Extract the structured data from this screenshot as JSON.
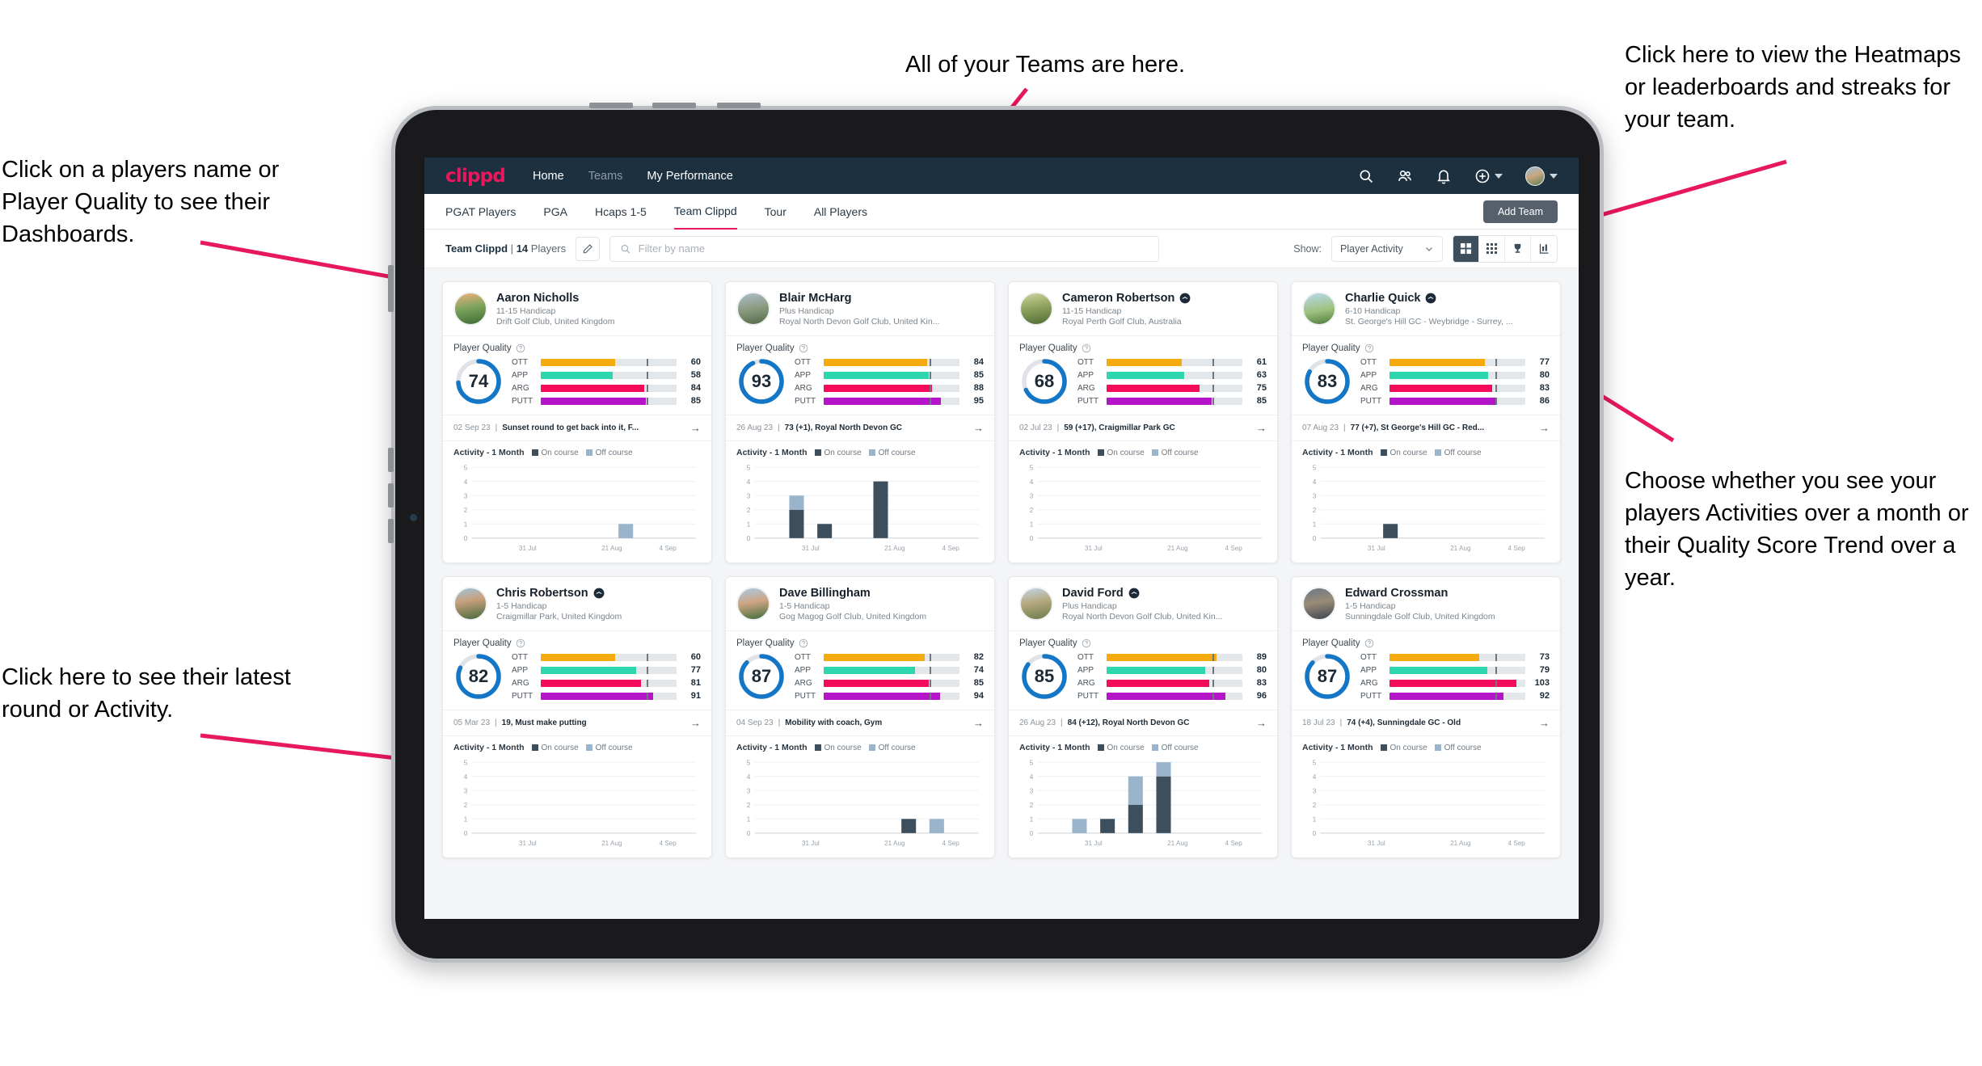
{
  "annotations": {
    "top_left": "Click on a players name or Player Quality to see their Dashboards.",
    "bottom_left": "Click here to see their latest round or Activity.",
    "top_center": "All of your Teams are here.",
    "top_right": "Click here to view the Heatmaps or leaderboards and streaks for your team.",
    "mid_right": "Choose whether you see your players Activities over a month or their Quality Score Trend over a year.",
    "arrow_color": "#e8185d"
  },
  "topnav": {
    "logo": "clippd",
    "links": [
      {
        "label": "Home",
        "active": true
      },
      {
        "label": "Teams",
        "active": false
      },
      {
        "label": "My Performance",
        "active": true
      }
    ],
    "icons": [
      "search-icon",
      "people-icon",
      "bell-icon",
      "plus-circle-icon",
      "avatar"
    ]
  },
  "subnav": {
    "tabs": [
      {
        "label": "PGAT Players",
        "state": "normal"
      },
      {
        "label": "PGA",
        "state": "normal"
      },
      {
        "label": "Hcaps 1-5",
        "state": "normal"
      },
      {
        "label": "Team Clippd",
        "state": "active"
      },
      {
        "label": "Tour",
        "state": "normal"
      },
      {
        "label": "All Players",
        "state": "normal"
      }
    ],
    "add_team_label": "Add Team"
  },
  "filterbar": {
    "team_name": "Team Clippd",
    "separator": "|",
    "player_count": "14",
    "players_word": "Players",
    "search_placeholder": "Filter by name",
    "search_value": "",
    "show_label": "Show:",
    "show_value": "Player Activity",
    "show_options": [
      "Player Activity",
      "Quality Score Trend"
    ],
    "view_buttons": [
      "grid-large-icon",
      "grid-small-icon",
      "trophy-icon",
      "chart-icon"
    ],
    "active_view": "grid-large-icon"
  },
  "card_labels": {
    "player_quality": "Player Quality",
    "activity": "Activity - 1 Month",
    "legend_on": "On course",
    "legend_off": "Off course"
  },
  "colors": {
    "ott": "#f5ab0d",
    "app": "#2ed6ae",
    "arg": "#f50b5c",
    "putt": "#b515c9",
    "ring": "#1476c6",
    "on_course": "#3d4f5c",
    "off_course": "#9ab4cc",
    "brand": "#e8185d",
    "nav_bg": "#1c3040"
  },
  "players": [
    {
      "name": "Aaron Nicholls",
      "verified": false,
      "handicap": "11-15 Handicap",
      "club": "Drift Golf Club, United Kingdom",
      "quality_score": 74,
      "metrics": [
        {
          "label": "OTT",
          "value": 60,
          "color": "ott"
        },
        {
          "label": "APP",
          "value": 58,
          "color": "app"
        },
        {
          "label": "ARG",
          "value": 84,
          "color": "arg"
        },
        {
          "label": "PUTT",
          "value": 85,
          "color": "putt"
        }
      ],
      "latest_date": "02 Sep 23",
      "latest_text": "Sunset round to get back into it, F...",
      "chart_data": {
        "type": "bar",
        "title": "Activity - 1 Month",
        "categories": [
          "31 Jul",
          "21 Aug",
          "4 Sep"
        ],
        "ylim": [
          0,
          5
        ],
        "yticks": [
          0,
          1,
          2,
          3,
          4,
          5
        ],
        "series": [
          {
            "name": "On course",
            "values": [
              0,
              0,
              0,
              0,
              0,
              0,
              0,
              0
            ]
          },
          {
            "name": "Off course",
            "values": [
              0,
              0,
              0,
              0,
              0,
              1,
              0,
              0
            ]
          }
        ]
      }
    },
    {
      "name": "Blair McHarg",
      "verified": false,
      "handicap": "Plus Handicap",
      "club": "Royal North Devon Golf Club, United Kin...",
      "quality_score": 93,
      "metrics": [
        {
          "label": "OTT",
          "value": 84,
          "color": "ott"
        },
        {
          "label": "APP",
          "value": 85,
          "color": "app"
        },
        {
          "label": "ARG",
          "value": 88,
          "color": "arg"
        },
        {
          "label": "PUTT",
          "value": 95,
          "color": "putt"
        }
      ],
      "latest_date": "26 Aug 23",
      "latest_text": "73 (+1), Royal North Devon GC",
      "chart_data": {
        "type": "bar",
        "title": "Activity - 1 Month",
        "categories": [
          "31 Jul",
          "21 Aug",
          "4 Sep"
        ],
        "ylim": [
          0,
          5
        ],
        "yticks": [
          0,
          1,
          2,
          3,
          4,
          5
        ],
        "series": [
          {
            "name": "On course",
            "values": [
              0,
              2,
              1,
              0,
              4,
              0,
              0,
              0
            ]
          },
          {
            "name": "Off course",
            "values": [
              0,
              1,
              0,
              0,
              0,
              0,
              0,
              0
            ]
          }
        ]
      }
    },
    {
      "name": "Cameron Robertson",
      "verified": true,
      "handicap": "11-15 Handicap",
      "club": "Royal Perth Golf Club, Australia",
      "quality_score": 68,
      "metrics": [
        {
          "label": "OTT",
          "value": 61,
          "color": "ott"
        },
        {
          "label": "APP",
          "value": 63,
          "color": "app"
        },
        {
          "label": "ARG",
          "value": 75,
          "color": "arg"
        },
        {
          "label": "PUTT",
          "value": 85,
          "color": "putt"
        }
      ],
      "latest_date": "02 Jul 23",
      "latest_text": "59 (+17), Craigmillar Park GC",
      "chart_data": {
        "type": "bar",
        "title": "Activity - 1 Month",
        "categories": [
          "31 Jul",
          "21 Aug",
          "4 Sep"
        ],
        "ylim": [
          0,
          5
        ],
        "yticks": [
          0,
          1,
          2,
          3,
          4,
          5
        ],
        "series": [
          {
            "name": "On course",
            "values": [
              0,
              0,
              0,
              0,
              0,
              0,
              0,
              0
            ]
          },
          {
            "name": "Off course",
            "values": [
              0,
              0,
              0,
              0,
              0,
              0,
              0,
              0
            ]
          }
        ]
      }
    },
    {
      "name": "Charlie Quick",
      "verified": true,
      "handicap": "6-10 Handicap",
      "club": "St. George's Hill GC - Weybridge - Surrey, ...",
      "quality_score": 83,
      "metrics": [
        {
          "label": "OTT",
          "value": 77,
          "color": "ott"
        },
        {
          "label": "APP",
          "value": 80,
          "color": "app"
        },
        {
          "label": "ARG",
          "value": 83,
          "color": "arg"
        },
        {
          "label": "PUTT",
          "value": 86,
          "color": "putt"
        }
      ],
      "latest_date": "07 Aug 23",
      "latest_text": "77 (+7), St George's Hill GC - Red...",
      "chart_data": {
        "type": "bar",
        "title": "Activity - 1 Month",
        "categories": [
          "31 Jul",
          "21 Aug",
          "4 Sep"
        ],
        "ylim": [
          0,
          5
        ],
        "yticks": [
          0,
          1,
          2,
          3,
          4,
          5
        ],
        "series": [
          {
            "name": "On course",
            "values": [
              0,
              0,
              1,
              0,
              0,
              0,
              0,
              0
            ]
          },
          {
            "name": "Off course",
            "values": [
              0,
              0,
              0,
              0,
              0,
              0,
              0,
              0
            ]
          }
        ]
      }
    },
    {
      "name": "Chris Robertson",
      "verified": true,
      "handicap": "1-5 Handicap",
      "club": "Craigmillar Park, United Kingdom",
      "quality_score": 82,
      "metrics": [
        {
          "label": "OTT",
          "value": 60,
          "color": "ott"
        },
        {
          "label": "APP",
          "value": 77,
          "color": "app"
        },
        {
          "label": "ARG",
          "value": 81,
          "color": "arg"
        },
        {
          "label": "PUTT",
          "value": 91,
          "color": "putt"
        }
      ],
      "latest_date": "05 Mar 23",
      "latest_text": "19, Must make putting",
      "chart_data": {
        "type": "bar",
        "title": "Activity - 1 Month",
        "categories": [
          "31 Jul",
          "21 Aug",
          "4 Sep"
        ],
        "ylim": [
          0,
          5
        ],
        "yticks": [
          0,
          1,
          2,
          3,
          4,
          5
        ],
        "series": [
          {
            "name": "On course",
            "values": [
              0,
              0,
              0,
              0,
              0,
              0,
              0,
              0
            ]
          },
          {
            "name": "Off course",
            "values": [
              0,
              0,
              0,
              0,
              0,
              0,
              0,
              0
            ]
          }
        ]
      }
    },
    {
      "name": "Dave Billingham",
      "verified": false,
      "handicap": "1-5 Handicap",
      "club": "Gog Magog Golf Club, United Kingdom",
      "quality_score": 87,
      "metrics": [
        {
          "label": "OTT",
          "value": 82,
          "color": "ott"
        },
        {
          "label": "APP",
          "value": 74,
          "color": "app"
        },
        {
          "label": "ARG",
          "value": 85,
          "color": "arg"
        },
        {
          "label": "PUTT",
          "value": 94,
          "color": "putt"
        }
      ],
      "latest_date": "04 Sep 23",
      "latest_text": "Mobility with coach, Gym",
      "chart_data": {
        "type": "bar",
        "title": "Activity - 1 Month",
        "categories": [
          "31 Jul",
          "21 Aug",
          "4 Sep"
        ],
        "ylim": [
          0,
          5
        ],
        "yticks": [
          0,
          1,
          2,
          3,
          4,
          5
        ],
        "series": [
          {
            "name": "On course",
            "values": [
              0,
              0,
              0,
              0,
              0,
              1,
              0,
              0
            ]
          },
          {
            "name": "Off course",
            "values": [
              0,
              0,
              0,
              0,
              0,
              0,
              1,
              0
            ]
          }
        ]
      }
    },
    {
      "name": "David Ford",
      "verified": true,
      "handicap": "Plus Handicap",
      "club": "Royal North Devon Golf Club, United Kin...",
      "quality_score": 85,
      "metrics": [
        {
          "label": "OTT",
          "value": 89,
          "color": "ott"
        },
        {
          "label": "APP",
          "value": 80,
          "color": "app"
        },
        {
          "label": "ARG",
          "value": 83,
          "color": "arg"
        },
        {
          "label": "PUTT",
          "value": 96,
          "color": "putt"
        }
      ],
      "latest_date": "26 Aug 23",
      "latest_text": "84 (+12), Royal North Devon GC",
      "chart_data": {
        "type": "bar",
        "title": "Activity - 1 Month",
        "categories": [
          "31 Jul",
          "21 Aug",
          "4 Sep"
        ],
        "ylim": [
          0,
          5
        ],
        "yticks": [
          0,
          1,
          2,
          3,
          4,
          5
        ],
        "series": [
          {
            "name": "On course",
            "values": [
              0,
              0,
              1,
              2,
              4,
              0,
              0,
              0
            ]
          },
          {
            "name": "Off course",
            "values": [
              0,
              1,
              0,
              2,
              1,
              0,
              0,
              0
            ]
          }
        ]
      }
    },
    {
      "name": "Edward Crossman",
      "verified": false,
      "handicap": "1-5 Handicap",
      "club": "Sunningdale Golf Club, United Kingdom",
      "quality_score": 87,
      "metrics": [
        {
          "label": "OTT",
          "value": 73,
          "color": "ott"
        },
        {
          "label": "APP",
          "value": 79,
          "color": "app"
        },
        {
          "label": "ARG",
          "value": 103,
          "color": "arg"
        },
        {
          "label": "PUTT",
          "value": 92,
          "color": "putt"
        }
      ],
      "latest_date": "18 Jul 23",
      "latest_text": "74 (+4), Sunningdale GC - Old",
      "chart_data": {
        "type": "bar",
        "title": "Activity - 1 Month",
        "categories": [
          "31 Jul",
          "21 Aug",
          "4 Sep"
        ],
        "ylim": [
          0,
          5
        ],
        "yticks": [
          0,
          1,
          2,
          3,
          4,
          5
        ],
        "series": [
          {
            "name": "On course",
            "values": [
              0,
              0,
              0,
              0,
              0,
              0,
              0,
              0
            ]
          },
          {
            "name": "Off course",
            "values": [
              0,
              0,
              0,
              0,
              0,
              0,
              0,
              0
            ]
          }
        ]
      }
    }
  ]
}
